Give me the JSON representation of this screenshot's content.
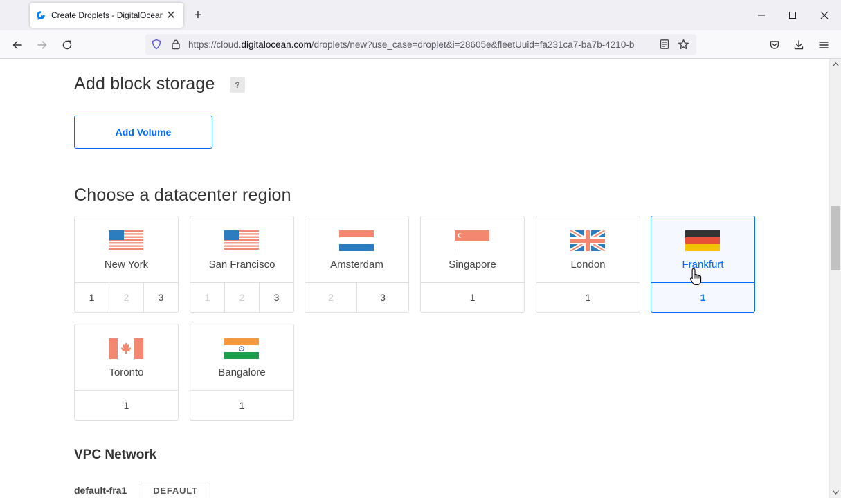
{
  "browser": {
    "tab_title": "Create Droplets - DigitalOcean",
    "url_prefix": "https://cloud.",
    "url_host": "digitalocean.com",
    "url_path": "/droplets/new?use_case=droplet&i=28605e&fleetUuid=fa231ca7-ba7b-4210-b"
  },
  "block_storage": {
    "title": "Add block storage",
    "help": "?",
    "add_volume_label": "Add Volume"
  },
  "datacenter": {
    "title": "Choose a datacenter region",
    "regions": [
      {
        "name": "New York",
        "flag": "flag-us-icon",
        "dcs": [
          {
            "n": "1",
            "enabled": true
          },
          {
            "n": "2",
            "enabled": false
          },
          {
            "n": "3",
            "enabled": true
          }
        ]
      },
      {
        "name": "San Francisco",
        "flag": "flag-us-icon",
        "dcs": [
          {
            "n": "1",
            "enabled": false
          },
          {
            "n": "2",
            "enabled": false
          },
          {
            "n": "3",
            "enabled": true
          }
        ]
      },
      {
        "name": "Amsterdam",
        "flag": "flag-nl-icon",
        "dcs": [
          {
            "n": "2",
            "enabled": false
          },
          {
            "n": "3",
            "enabled": true
          }
        ]
      },
      {
        "name": "Singapore",
        "flag": "flag-sg-icon",
        "dcs": [
          {
            "n": "1",
            "enabled": true
          }
        ]
      },
      {
        "name": "London",
        "flag": "flag-uk-icon",
        "dcs": [
          {
            "n": "1",
            "enabled": true
          }
        ]
      },
      {
        "name": "Frankfurt",
        "flag": "flag-de-icon",
        "selected": true,
        "dcs": [
          {
            "n": "1",
            "enabled": true
          }
        ]
      },
      {
        "name": "Toronto",
        "flag": "flag-ca-icon",
        "dcs": [
          {
            "n": "1",
            "enabled": true
          }
        ]
      },
      {
        "name": "Bangalore",
        "flag": "flag-in-icon",
        "dcs": [
          {
            "n": "1",
            "enabled": true
          }
        ]
      }
    ]
  },
  "vpc": {
    "title": "VPC Network",
    "network_name": "default-fra1",
    "badge": "DEFAULT"
  },
  "colors": {
    "accent": "#0069ff",
    "flag_red": "#f4876f",
    "flag_blue": "#2b7dc0"
  }
}
